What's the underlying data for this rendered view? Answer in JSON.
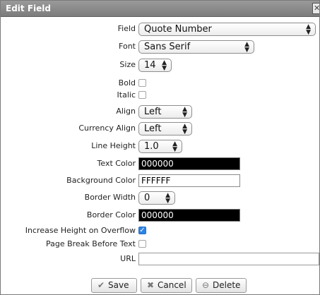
{
  "dialog": {
    "title": "Edit Field",
    "close_icon": "close-icon"
  },
  "fields": {
    "field": {
      "label": "Field",
      "value": "Quote Number"
    },
    "font": {
      "label": "Font",
      "value": "Sans Serif"
    },
    "size": {
      "label": "Size",
      "value": "14"
    },
    "bold": {
      "label": "Bold",
      "checked": false
    },
    "italic": {
      "label": "Italic",
      "checked": false
    },
    "align": {
      "label": "Align",
      "value": "Left"
    },
    "currency_align": {
      "label": "Currency Align",
      "value": "Left"
    },
    "line_height": {
      "label": "Line Height",
      "value": "1.0"
    },
    "text_color": {
      "label": "Text Color",
      "value": "000000",
      "color": "#000000",
      "text_color": "#ffffff"
    },
    "background_color": {
      "label": "Background Color",
      "value": "FFFFFF",
      "color": "#ffffff",
      "text_color": "#000000"
    },
    "border_width": {
      "label": "Border Width",
      "value": "0"
    },
    "border_color": {
      "label": "Border Color",
      "value": "000000",
      "color": "#000000",
      "text_color": "#ffffff"
    },
    "increase_height": {
      "label": "Increase Height on Overflow",
      "checked": true
    },
    "page_break": {
      "label": "Page Break Before Text",
      "checked": false
    },
    "url": {
      "label": "URL",
      "value": ""
    }
  },
  "buttons": {
    "save": {
      "label": "Save",
      "icon": "check-icon"
    },
    "cancel": {
      "label": "Cancel",
      "icon": "x-icon"
    },
    "delete": {
      "label": "Delete",
      "icon": "minus-circle-icon"
    }
  },
  "colors": {
    "accent": "#2a84e6",
    "titlebar": "#8a8a8a"
  }
}
